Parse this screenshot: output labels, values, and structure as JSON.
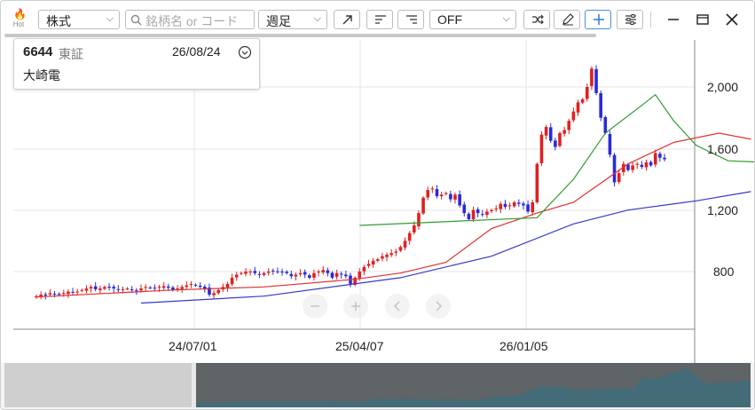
{
  "toolbar": {
    "hot_label": "Hot",
    "market_select": "株式",
    "search_placeholder": "銘柄名 or コード",
    "period_select": "週足",
    "mode_select": "OFF",
    "icons": [
      "flame-icon",
      "search-icon",
      "arrow-up-right-icon",
      "align-left-icon",
      "align-right-icon",
      "shuffle-icon",
      "pencil-icon",
      "crosshair-plus-icon",
      "settings-sliders-icon",
      "minimize-icon",
      "maximize-icon",
      "close-icon"
    ]
  },
  "info": {
    "code": "6644",
    "exchange": "東証",
    "date": "26/08/24",
    "name": "大崎電"
  },
  "axes": {
    "y_ticks": [
      "2,000",
      "1,600",
      "1,200",
      "800"
    ],
    "x_ticks": [
      "24/07/01",
      "25/04/07",
      "26/01/05"
    ]
  },
  "chart_data": {
    "type": "candlestick",
    "ylim": [
      580,
      2230
    ],
    "y_ticks": [
      800,
      1200,
      1600,
      2000
    ],
    "x_ticks": [
      "24/07/01",
      "25/04/07",
      "26/01/05"
    ],
    "grid": true,
    "colors": {
      "up": "#e02020",
      "down": "#2a2ad8",
      "ma_short": "#2e9e2e",
      "ma_mid": "#e23030",
      "ma_long": "#3838cc"
    },
    "close_series": [
      640,
      650,
      645,
      660,
      655,
      650,
      660,
      670,
      665,
      670,
      680,
      690,
      700,
      685,
      690,
      700,
      695,
      690,
      680,
      685,
      690,
      680,
      675,
      690,
      700,
      695,
      690,
      700,
      705,
      695,
      680,
      690,
      700,
      710,
      720,
      710,
      700,
      690,
      650,
      660,
      680,
      700,
      720,
      760,
      780,
      790,
      800,
      800,
      790,
      780,
      790,
      800,
      805,
      800,
      795,
      790,
      770,
      780,
      790,
      780,
      760,
      790,
      800,
      810,
      790,
      760,
      790,
      780,
      770,
      720,
      760,
      800,
      830,
      850,
      870,
      880,
      900,
      910,
      920,
      930,
      960,
      1000,
      1050,
      1100,
      1180,
      1280,
      1330,
      1340,
      1290,
      1300,
      1310,
      1270,
      1300,
      1230,
      1180,
      1140,
      1200,
      1180,
      1170,
      1190,
      1200,
      1210,
      1240,
      1220,
      1230,
      1250,
      1240,
      1230,
      1190,
      1250,
      1500,
      1690,
      1740,
      1650,
      1610,
      1700,
      1720,
      1780,
      1840,
      1900,
      1920,
      2000,
      2120,
      1960,
      1800,
      1700,
      1560,
      1380,
      1440,
      1500,
      1460,
      1490,
      1500,
      1480,
      1510,
      1490,
      1570,
      1540,
      1530
    ],
    "ma_short": [
      [
        71,
        1100
      ],
      [
        110,
        1150
      ],
      [
        118,
        1400
      ],
      [
        125,
        1700
      ],
      [
        133,
        1880
      ],
      [
        136,
        1950
      ],
      [
        140,
        1780
      ],
      [
        145,
        1620
      ],
      [
        152,
        1520
      ],
      [
        160,
        1510
      ]
    ],
    "ma_mid": [
      [
        0,
        635
      ],
      [
        30,
        680
      ],
      [
        50,
        700
      ],
      [
        70,
        750
      ],
      [
        80,
        790
      ],
      [
        90,
        860
      ],
      [
        100,
        1080
      ],
      [
        110,
        1180
      ],
      [
        118,
        1250
      ],
      [
        130,
        1500
      ],
      [
        140,
        1640
      ],
      [
        150,
        1700
      ],
      [
        157,
        1660
      ]
    ],
    "ma_long": [
      [
        23,
        595
      ],
      [
        50,
        640
      ],
      [
        80,
        760
      ],
      [
        100,
        900
      ],
      [
        118,
        1110
      ],
      [
        130,
        1200
      ],
      [
        145,
        1260
      ],
      [
        157,
        1320
      ]
    ]
  }
}
